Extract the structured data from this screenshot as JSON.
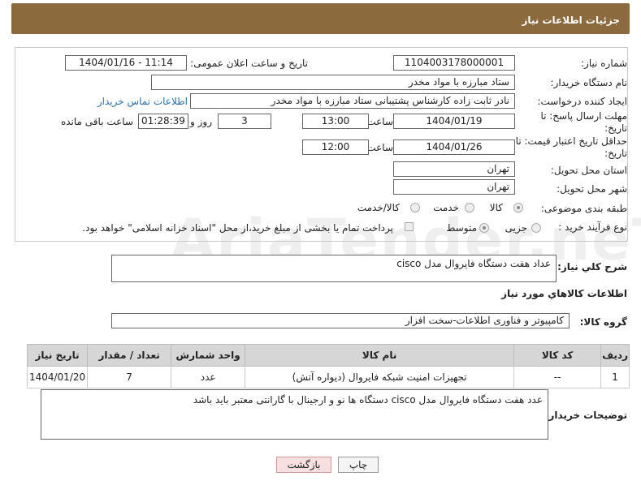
{
  "header": {
    "title": "جزئیات اطلاعات نیاز"
  },
  "form": {
    "need_number_label": "شماره نیاز:",
    "need_number": "1104003178000001",
    "announce_label": "تاریخ و ساعت اعلان عمومی:",
    "announce_value": "1404/01/16 - 11:14",
    "buyer_label": "نام دستگاه خریدار:",
    "buyer_value": "ستاد مبارزه با مواد مخدر",
    "creator_label": "ایجاد کننده درخواست:",
    "creator_value": "نادر ثابت زاده کارشناس پشتیبانی ستاد مبارزه با مواد مخدر",
    "contact_link": "اطلاعات تماس خریدار",
    "deadline_label": "مهلت ارسال پاسخ: تا تاریخ:",
    "deadline_date": "1404/01/19",
    "time_label": "ساعت",
    "deadline_time": "13:00",
    "days_value": "3",
    "days_label": "روز و",
    "remaining_value": "01:28:39",
    "remaining_label": "ساعت باقی مانده",
    "validity_label": "حداقل تاریخ اعتبار قیمت: تا تاریخ:",
    "validity_date": "1404/01/26",
    "validity_time_label": "ساعت",
    "validity_time": "12:00",
    "province_label": "استان محل تحویل:",
    "province_value": "تهران",
    "city_label": "شهر محل تحویل:",
    "city_value": "تهران",
    "category_label": "طبقه بندی موضوعی:",
    "category_options": [
      "کالا",
      "خدمت",
      "کالا/خدمت"
    ],
    "process_label": "نوع فرآیند خرید :",
    "process_options": [
      "جزیی",
      "متوسط"
    ],
    "payment_text": "پرداخت تمام یا بخشی از مبلغ خرید،از محل \"اسناد خزانه اسلامی\" خواهد بود."
  },
  "summary": {
    "label": "شرح کلي نياز:",
    "value": "عداد هفت دستگاه فایروال مدل cisco"
  },
  "goods_info_title": "اطلاعات کالاهاي مورد نياز",
  "goods_group": {
    "label": "گروه کالا:",
    "value": "کامپیوتر و فناوری اطلاعات-سخت افزار"
  },
  "table": {
    "headers": [
      "رديف",
      "کد کالا",
      "نام کالا",
      "واحد شمارش",
      "تعداد / مقدار",
      "تاریخ نیاز"
    ],
    "rows": [
      [
        "1",
        "--",
        "تجهیزات امنیت شبکه فایروال (دیواره آتش)",
        "عدد",
        "7",
        "1404/01/20"
      ]
    ]
  },
  "buyer_notes": {
    "label": "توضیحات خریدار:",
    "value": "عدد هفت دستگاه فایروال مدل cisco دستگاه ها نو و ارجینال با گارانتی معتبر باید باشد"
  },
  "buttons": {
    "print": "چاپ",
    "back": "بازگشت"
  },
  "watermark": "AriaTender.neT",
  "colors": {
    "header_bg": "#8b6a3e",
    "back_button_bg": "#f8e0e0"
  }
}
